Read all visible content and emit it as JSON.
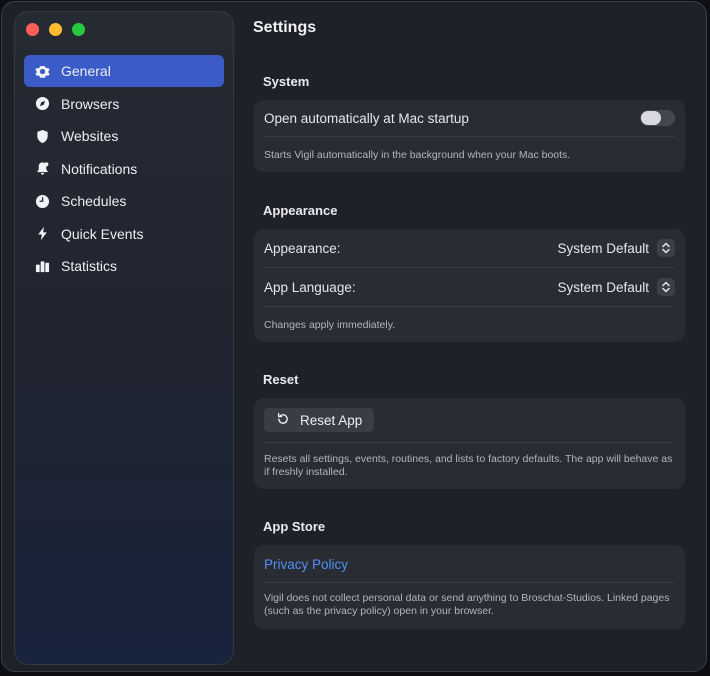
{
  "sidebar": {
    "items": [
      {
        "label": "General",
        "icon": "gear-icon",
        "active": true
      },
      {
        "label": "Browsers",
        "icon": "compass-icon"
      },
      {
        "label": "Websites",
        "icon": "shield-icon"
      },
      {
        "label": "Notifications",
        "icon": "bell-icon"
      },
      {
        "label": "Schedules",
        "icon": "clock-icon"
      },
      {
        "label": "Quick Events",
        "icon": "bolt-icon"
      },
      {
        "label": "Statistics",
        "icon": "chart-bars-icon"
      }
    ]
  },
  "main": {
    "title": "Settings",
    "system": {
      "title": "System",
      "startup_label": "Open automatically at Mac startup",
      "startup_enabled": false,
      "caption": "Starts Vigil automatically in the background when your Mac boots."
    },
    "appearance": {
      "title": "Appearance",
      "appearance_label": "Appearance:",
      "appearance_value": "System Default",
      "language_label": "App Language:",
      "language_value": "System Default",
      "caption": "Changes apply immediately."
    },
    "reset": {
      "title": "Reset",
      "button_label": "Reset App",
      "caption": "Resets all settings, events, routines, and lists to factory defaults. The app will behave as if freshly installed."
    },
    "appstore": {
      "title": "App Store",
      "privacy_link": "Privacy Policy",
      "caption": "Vigil does not collect personal data or send anything to Broschat-Studios. Linked pages (such as the privacy policy) open in your browser."
    }
  },
  "colors": {
    "accent": "#3b5cc6",
    "link": "#4f8ff7",
    "close": "#ff5f57",
    "minimize": "#febc2e",
    "maximize": "#28c840"
  }
}
